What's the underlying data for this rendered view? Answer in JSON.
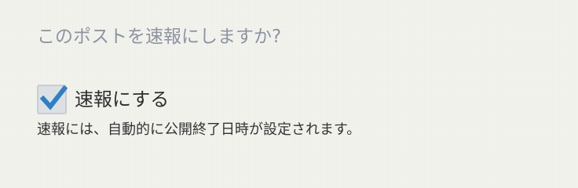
{
  "form": {
    "question": "このポストを速報にしますか?",
    "option": {
      "label": "速報にする",
      "checked": true,
      "check_color": "#2d80c8"
    },
    "help_text": "速報には、自動的に公開終了日時が設定されます。"
  }
}
